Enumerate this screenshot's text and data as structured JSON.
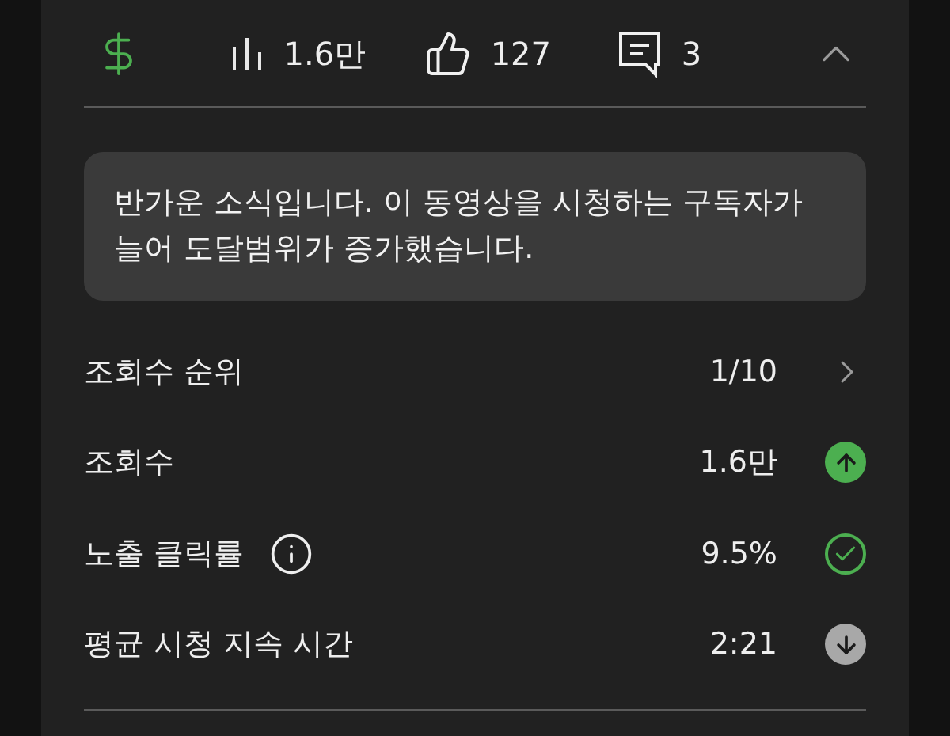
{
  "stats_bar": {
    "monetized": true,
    "items": [
      {
        "kind": "views",
        "value": "1.6만"
      },
      {
        "kind": "likes",
        "value": "127"
      },
      {
        "kind": "comments",
        "value": "3"
      }
    ],
    "expanded": true
  },
  "notice": "반가운 소식입니다. 이 동영상을 시청하는 구독자가 늘어 도달범위가 증가했습니다.",
  "metrics": [
    {
      "label": "조회수 순위",
      "value": "1/10",
      "kind": "link",
      "info": false
    },
    {
      "label": "조회수",
      "value": "1.6만",
      "kind": "up",
      "info": false
    },
    {
      "label": "노출 클릭률",
      "value": "9.5%",
      "kind": "check",
      "info": true
    },
    {
      "label": "평균 시청 지속 시간",
      "value": "2:21",
      "kind": "down",
      "info": false
    }
  ]
}
